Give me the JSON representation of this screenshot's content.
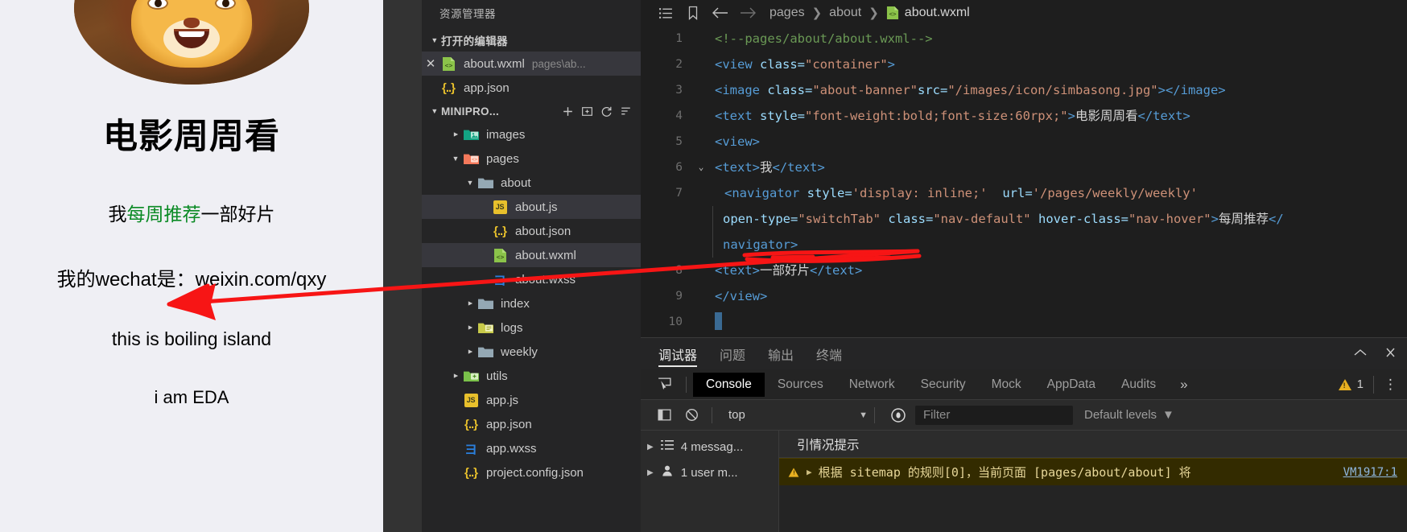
{
  "simulator": {
    "title": "电影周周看",
    "banner_alt": "simbasong.jpg",
    "lines": [
      {
        "pre": "我",
        "link": "每周推荐",
        "post": "一部好片"
      },
      {
        "text": "我的wechat是：weixin.com/qxy"
      },
      {
        "text": "this is boiling island"
      },
      {
        "text": "i am EDA"
      }
    ]
  },
  "explorer": {
    "title": "资源管理器",
    "open_editors": {
      "label": "打开的编辑器",
      "items": [
        {
          "name": "about.wxml",
          "sub": "pages\\ab...",
          "icon": "wxml-icon",
          "closable": true,
          "active": true
        },
        {
          "name": "app.json",
          "sub": "",
          "icon": "json-icon",
          "closable": false,
          "active": false
        }
      ]
    },
    "project": {
      "label": "MINIPRO...",
      "actions": [
        "new-file-icon",
        "new-folder-icon",
        "refresh-icon",
        "collapse-all-icon"
      ],
      "tree": [
        {
          "name": "images",
          "depth": 1,
          "type": "folder",
          "icon": "folder-images-icon",
          "expanded": false,
          "arrow": true
        },
        {
          "name": "pages",
          "depth": 1,
          "type": "folder",
          "icon": "folder-pages-icon",
          "expanded": true,
          "arrow": true
        },
        {
          "name": "about",
          "depth": 2,
          "type": "folder",
          "icon": "folder-icon",
          "expanded": true,
          "arrow": true
        },
        {
          "name": "about.js",
          "depth": 3,
          "type": "file",
          "icon": "js-icon",
          "selected": true
        },
        {
          "name": "about.json",
          "depth": 3,
          "type": "file",
          "icon": "json-icon"
        },
        {
          "name": "about.wxml",
          "depth": 3,
          "type": "file",
          "icon": "wxml-icon",
          "active": true
        },
        {
          "name": "about.wxss",
          "depth": 3,
          "type": "file",
          "icon": "wxss-icon"
        },
        {
          "name": "index",
          "depth": 2,
          "type": "folder",
          "icon": "folder-icon",
          "expanded": false,
          "arrow": true
        },
        {
          "name": "logs",
          "depth": 2,
          "type": "folder",
          "icon": "folder-logs-icon",
          "expanded": false,
          "arrow": true
        },
        {
          "name": "weekly",
          "depth": 2,
          "type": "folder",
          "icon": "folder-icon",
          "expanded": false,
          "arrow": true
        },
        {
          "name": "utils",
          "depth": 1,
          "type": "folder",
          "icon": "folder-utils-icon",
          "expanded": false,
          "arrow": true
        },
        {
          "name": "app.js",
          "depth": 1,
          "type": "file",
          "icon": "js-icon"
        },
        {
          "name": "app.json",
          "depth": 1,
          "type": "file",
          "icon": "json-icon"
        },
        {
          "name": "app.wxss",
          "depth": 1,
          "type": "file",
          "icon": "wxss-icon"
        },
        {
          "name": "project.config.json",
          "depth": 1,
          "type": "file",
          "icon": "json-icon"
        }
      ]
    }
  },
  "breadcrumb": {
    "icons": [
      "outline-icon",
      "bookmark-icon",
      "back-arrow-icon",
      "forward-arrow-icon"
    ],
    "path": [
      "pages",
      "about"
    ],
    "file": "about.wxml"
  },
  "editor": {
    "lines": [
      {
        "no": "1",
        "fold": "",
        "html": "<span class='t-com'>&lt;!--pages/about/about.wxml--&gt;</span>"
      },
      {
        "no": "2",
        "fold": "",
        "html": "<span class='t-tag'>&lt;view</span> <span class='t-attr'>class=</span><span class='t-str'>\"container\"</span><span class='t-tag'>&gt;</span>"
      },
      {
        "no": "3",
        "fold": "",
        "html": "<span class='t-tag'>&lt;image</span> <span class='t-attr'>class=</span><span class='t-str'>\"about-banner\"</span><span class='t-attr'>src=</span><span class='t-str'>\"/images/icon/simbasong.jpg\"</span><span class='t-tag'>&gt;&lt;/image&gt;</span>"
      },
      {
        "no": "4",
        "fold": "",
        "html": "<span class='t-tag'>&lt;text</span> <span class='t-attr'>style=</span><span class='t-str'>\"font-weight:bold;font-size:60rpx;\"</span><span class='t-tag'>&gt;</span><span class='t-txt'>电影周周看</span><span class='t-tag'>&lt;/text&gt;</span>"
      },
      {
        "no": "5",
        "fold": "",
        "html": "<span class='t-tag'>&lt;view&gt;</span>"
      },
      {
        "no": "6",
        "fold": "v",
        "html": "<span class='t-tag'>&lt;text&gt;</span><span class='t-txt'>我</span><span class='t-tag'>&lt;/text&gt;</span>"
      },
      {
        "no": "7",
        "fold": "",
        "html": "<span class='t-tag'>&lt;navigator</span> <span class='t-attr'>style=</span><span class='t-str'>'display: inline;'</span>  <span class='t-attr'>url=</span><span class='t-str'>'/pages/weekly/weekly'</span>"
      },
      {
        "no": "",
        "fold": "",
        "html": "<span class='t-attr'>open-type=</span><span class='t-str'>\"switchTab\"</span> <span class='t-attr'>class=</span><span class='t-str'>\"nav-default\"</span> <span class='t-attr'>hover-class=</span><span class='t-str'>\"nav-hover\"</span><span class='t-tag'>&gt;</span><span class='t-txt'>每周推荐</span><span class='t-tag'>&lt;/</span>"
      },
      {
        "no": "",
        "fold": "",
        "html": "<span class='t-tag'>navigator&gt;</span>"
      },
      {
        "no": "8",
        "fold": "",
        "html": "<span class='t-tag'>&lt;text&gt;</span><span class='t-txt'>一部好片</span><span class='t-tag'>&lt;/text&gt;</span>"
      },
      {
        "no": "9",
        "fold": "",
        "html": "<span class='t-tag'>&lt;/view&gt;</span>"
      },
      {
        "no": "10",
        "fold": "",
        "html": "<span class='caret'></span>"
      }
    ]
  },
  "panel": {
    "tabs": [
      {
        "label": "调试器",
        "active": true
      },
      {
        "label": "问题",
        "active": false
      },
      {
        "label": "输出",
        "active": false
      },
      {
        "label": "终端",
        "active": false
      }
    ],
    "right_icons": [
      "chevron-up-icon",
      "close-icon"
    ]
  },
  "devtools": {
    "tabs": [
      "Console",
      "Sources",
      "Network",
      "Security",
      "Mock",
      "AppData",
      "Audits"
    ],
    "active_tab": "Console",
    "overflow_label": "»",
    "warning_count": "1",
    "toolbar": {
      "context": "top",
      "filter_placeholder": "Filter",
      "levels": "Default levels"
    },
    "counts": [
      {
        "label": "4 messag...",
        "icon": "list-icon"
      },
      {
        "label": "1 user m...",
        "icon": "user-icon"
      }
    ],
    "group_header": "引情况提示",
    "messages": [
      {
        "text": "根据 sitemap 的规则[0]，当前页面 [pages/about/about] 将",
        "link": "VM1917:1",
        "level": "warning"
      }
    ]
  },
  "colors": {
    "accent_green": "#0a8a24",
    "annotation_red": "#f71515",
    "warning_yellow": "#e8b021",
    "editor_bg": "#1e1e1e",
    "sidebar_bg": "#252526"
  }
}
